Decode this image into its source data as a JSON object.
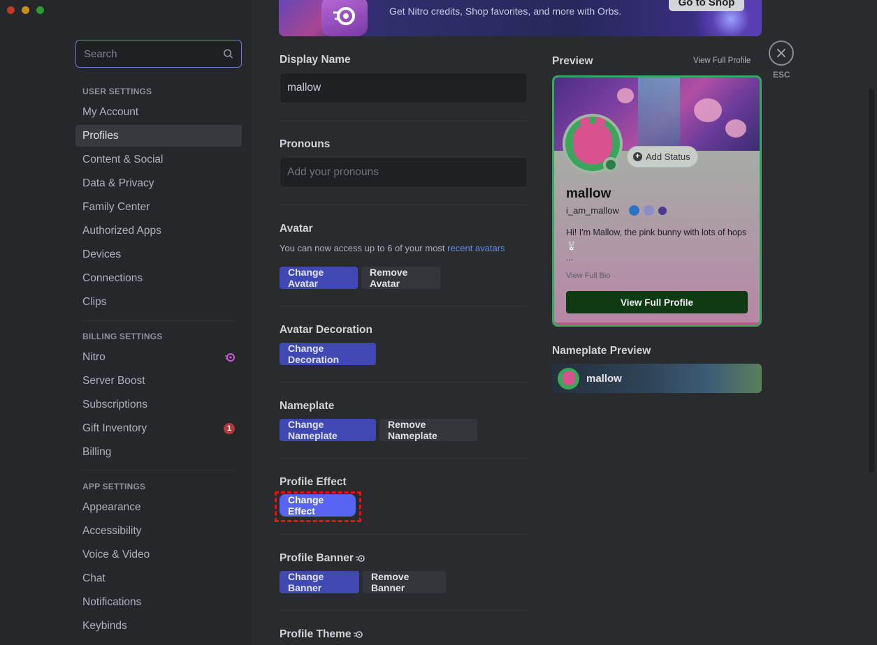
{
  "sidebar": {
    "search_placeholder": "Search",
    "sections": [
      {
        "header": "USER SETTINGS",
        "items": [
          {
            "label": "My Account"
          },
          {
            "label": "Profiles",
            "active": true
          },
          {
            "label": "Content & Social"
          },
          {
            "label": "Data & Privacy"
          },
          {
            "label": "Family Center"
          },
          {
            "label": "Authorized Apps"
          },
          {
            "label": "Devices"
          },
          {
            "label": "Connections"
          },
          {
            "label": "Clips"
          }
        ]
      },
      {
        "header": "BILLING SETTINGS",
        "items": [
          {
            "label": "Nitro",
            "icon": "nitro-icon"
          },
          {
            "label": "Server Boost"
          },
          {
            "label": "Subscriptions"
          },
          {
            "label": "Gift Inventory",
            "badge": "1"
          },
          {
            "label": "Billing"
          }
        ]
      },
      {
        "header": "APP SETTINGS",
        "items": [
          {
            "label": "Appearance"
          },
          {
            "label": "Accessibility"
          },
          {
            "label": "Voice & Video"
          },
          {
            "label": "Chat"
          },
          {
            "label": "Notifications"
          },
          {
            "label": "Keybinds"
          }
        ]
      }
    ]
  },
  "promo": {
    "text": "Get Nitro credits, Shop favorites, and more with Orbs.",
    "button": "Go to Shop"
  },
  "form": {
    "display_name_label": "Display Name",
    "display_name_value": "mallow",
    "pronouns_label": "Pronouns",
    "pronouns_placeholder": "Add your pronouns",
    "avatar_label": "Avatar",
    "avatar_help": "You can now access up to 6 of your most ",
    "avatar_help_link": "recent avatars",
    "change_avatar": "Change Avatar",
    "remove_avatar": "Remove Avatar",
    "decoration_label": "Avatar Decoration",
    "change_decoration": "Change Decoration",
    "nameplate_label": "Nameplate",
    "change_nameplate": "Change Nameplate",
    "remove_nameplate": "Remove Nameplate",
    "effect_label": "Profile Effect",
    "change_effect": "Change Effect",
    "banner_label": "Profile Banner",
    "change_banner": "Change Banner",
    "remove_banner": "Remove Banner",
    "theme_label": "Profile Theme"
  },
  "preview": {
    "label": "Preview",
    "view_full_link": "View Full Profile",
    "add_status": "Add Status",
    "name": "mallow",
    "username": "i_am_mallow",
    "bio": "Hi! I'm Mallow, the pink bunny with lots of hops 🐰",
    "bio_more": "...",
    "view_full_bio": "View Full Bio",
    "view_full_profile_btn": "View Full Profile"
  },
  "nameplate_preview": {
    "label": "Nameplate Preview",
    "name": "mallow"
  },
  "close": {
    "esc_label": "ESC"
  },
  "colors": {
    "accent": "#5865f2",
    "primary_button": "#4049b3",
    "highlight": "#ee1111",
    "online": "#2d7d46"
  }
}
